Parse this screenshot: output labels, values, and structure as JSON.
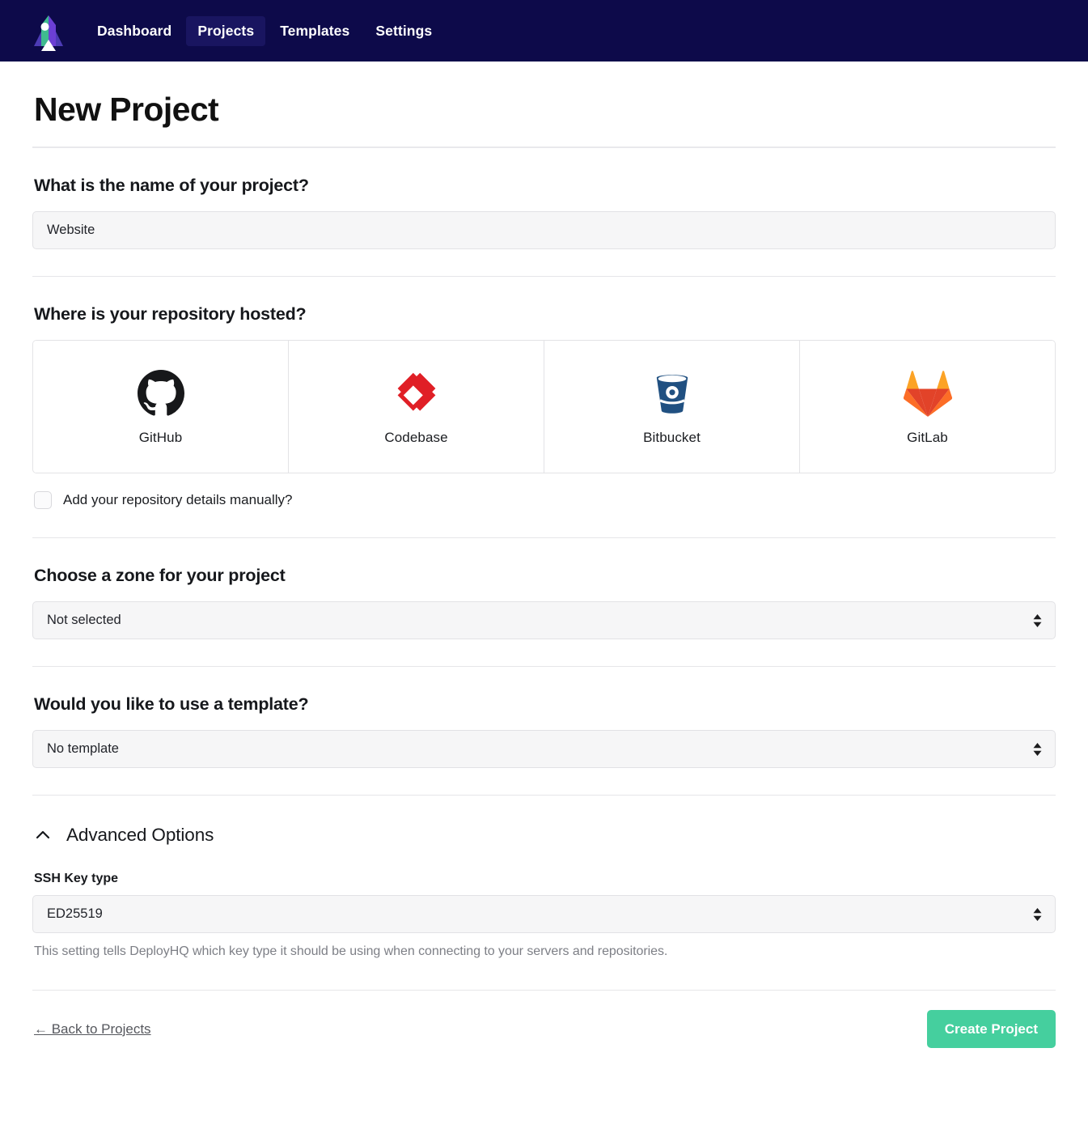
{
  "nav": {
    "logo_icon": "rocket-logo-icon",
    "links": [
      {
        "label": "Dashboard",
        "active": false
      },
      {
        "label": "Projects",
        "active": true
      },
      {
        "label": "Templates",
        "active": false
      },
      {
        "label": "Settings",
        "active": false
      }
    ]
  },
  "page": {
    "title": "New Project"
  },
  "project_name": {
    "label": "What is the name of your project?",
    "value": "Website",
    "placeholder": "Website"
  },
  "repository": {
    "label": "Where is your repository hosted?",
    "providers": [
      {
        "name": "GitHub",
        "icon": "github-icon",
        "color": "#17181a"
      },
      {
        "name": "Codebase",
        "icon": "codebase-icon",
        "color": "#e01f26"
      },
      {
        "name": "Bitbucket",
        "icon": "bitbucket-icon",
        "color": "#205081"
      },
      {
        "name": "GitLab",
        "icon": "gitlab-icon",
        "color": "#e24329"
      }
    ],
    "manual_checkbox_label": "Add your repository details manually?",
    "manual_checkbox_checked": false
  },
  "zone": {
    "label": "Choose a zone for your project",
    "value": "Not selected"
  },
  "template": {
    "label": "Would you like to use a template?",
    "value": "No template"
  },
  "advanced": {
    "title": "Advanced Options",
    "expanded": true,
    "chevron_icon": "chevron-up-icon",
    "ssh_key_label": "SSH Key type",
    "ssh_key_value": "ED25519",
    "ssh_key_help": "This setting tells DeployHQ which key type it should be using when connecting to your servers and repositories."
  },
  "footer": {
    "back_label": "← Back to Projects",
    "create_label": "Create Project",
    "create_color": "#45cf9e"
  }
}
